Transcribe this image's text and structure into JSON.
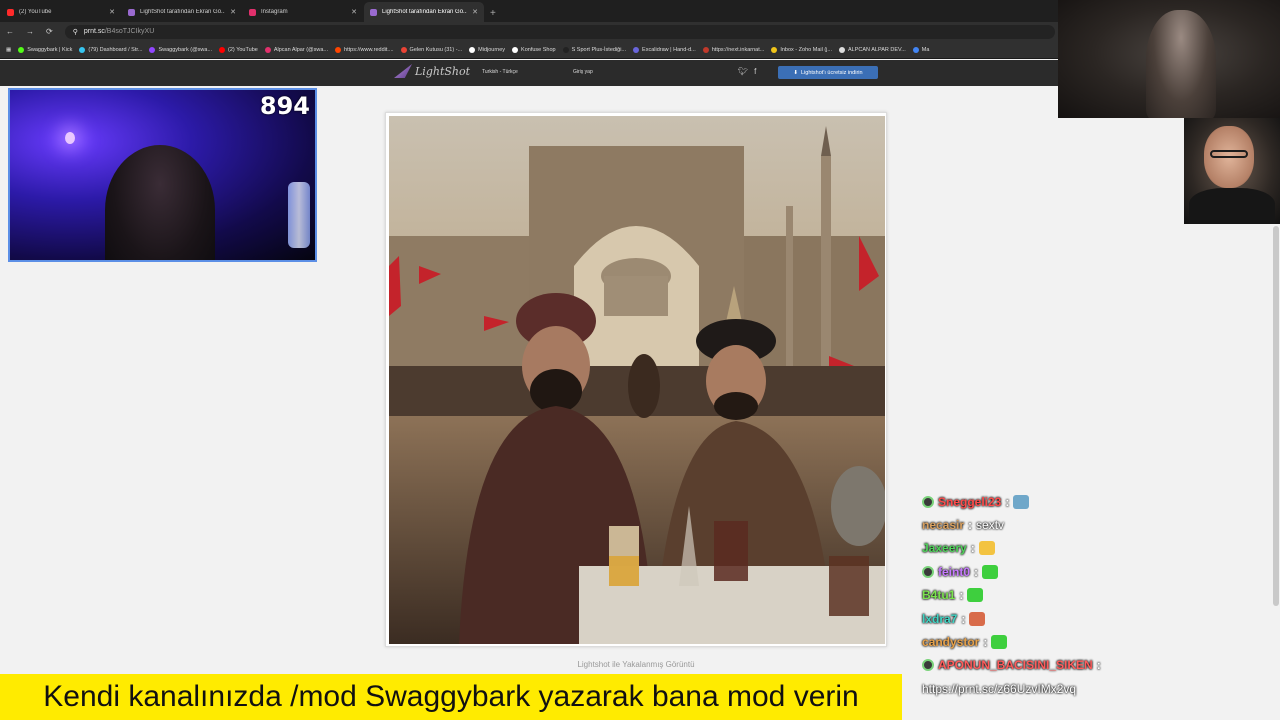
{
  "browser": {
    "tabs": [
      {
        "title": "(2) YouTube",
        "fav": "#ff2a2a",
        "active": false
      },
      {
        "title": "LightShot tarafından Ekran Gö...",
        "fav": "#9a6ad0",
        "active": false
      },
      {
        "title": "Instagram",
        "fav": "#e1306c",
        "active": false
      },
      {
        "title": "LightShot tarafından Ekran Gö...",
        "fav": "#9a6ad0",
        "active": true
      }
    ],
    "url_host": "prnt.sc",
    "url_path": "/B4soTJCIkyXU",
    "bookmarks": [
      {
        "label": "Swaggybark | Kick",
        "color": "#53fc18"
      },
      {
        "label": "(79) Dashboard / Str...",
        "color": "#36c5f0"
      },
      {
        "label": "Swaggybark (@swa...",
        "color": "#9146ff"
      },
      {
        "label": "(2) YouTube",
        "color": "#ff0000"
      },
      {
        "label": "Alpcan Alpar (@swa...",
        "color": "#e1306c"
      },
      {
        "label": "https://www.reddit....",
        "color": "#ff4500"
      },
      {
        "label": "Gelen Kutusu (31) -...",
        "color": "#ea4335"
      },
      {
        "label": "Midjourney",
        "color": "#ffffff"
      },
      {
        "label": "Konfuse Shop",
        "color": "#ffffff"
      },
      {
        "label": "S Sport Plus-İstediği...",
        "color": "#222222"
      },
      {
        "label": "Excalidraw | Hand-d...",
        "color": "#6965db"
      },
      {
        "label": "https://next.inkarnat...",
        "color": "#c0392b"
      },
      {
        "label": "Inbox - Zoho Mail (j...",
        "color": "#f0c419"
      },
      {
        "label": "ALPCAN ALPAR DEV...",
        "color": "#dddddd"
      },
      {
        "label": "Ma",
        "color": "#4285f4"
      }
    ]
  },
  "lightshot": {
    "logo": "LightShot",
    "lang": "Turkish - Türkçe",
    "login": "Giriş yap",
    "download": "Lightshot'ı ücretsiz indirin",
    "caption": "Lightshot ile Yakalanmış Görüntü"
  },
  "stream": {
    "viewer_count": "894",
    "banner": "Kendi kanalınızda /mod Swaggybark yazarak bana mod verin"
  },
  "chat": [
    {
      "user": "Sneggeli23",
      "color": "#ff4b4b",
      "msg": "",
      "badge": true,
      "emote": "#6fa7c9"
    },
    {
      "user": "necasir",
      "color": "#d8a060",
      "msg": "sextv",
      "badge": false,
      "emote": ""
    },
    {
      "user": "Jaxeery",
      "color": "#4fd35a",
      "msg": "",
      "badge": false,
      "emote": "#f3c341"
    },
    {
      "user": "feint0",
      "color": "#c779ff",
      "msg": "",
      "badge": true,
      "emote": "#3ecf3e"
    },
    {
      "user": "B4tu1",
      "color": "#7be34f",
      "msg": "",
      "badge": false,
      "emote": "#3ecf3e"
    },
    {
      "user": "lxdra7",
      "color": "#3fd4c4",
      "msg": "",
      "badge": false,
      "emote": "#d86b4a"
    },
    {
      "user": "candystor",
      "color": "#e8a24a",
      "msg": "",
      "badge": false,
      "emote": "#3ecf3e"
    },
    {
      "user": "APONUN_BACISINI_SIKEN",
      "color": "#ff5c5c",
      "msg": "",
      "badge": true,
      "emote": ""
    },
    {
      "user": "",
      "color": "#ffffff",
      "msg": "https://prnt.sc/z66UzvIMx2vq",
      "badge": false,
      "emote": ""
    }
  ],
  "colors": {
    "banner_bg": "#ffeb00",
    "cam_border": "#5c8fe6",
    "lightshot_button": "#3b6fb6"
  }
}
